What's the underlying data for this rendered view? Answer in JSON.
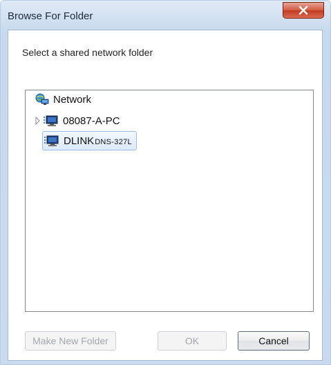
{
  "window": {
    "title": "Browse For Folder"
  },
  "dialog": {
    "instruction": "Select a shared network folder"
  },
  "tree": {
    "root": {
      "label": "Network",
      "icon": "network-icon"
    },
    "items": [
      {
        "label": "08087-A-PC",
        "sub": "",
        "icon": "computer-icon",
        "expandable": true,
        "selected": false
      },
      {
        "label": "DLINK",
        "sub": "DNS-327L",
        "icon": "computer-icon",
        "expandable": false,
        "selected": true
      }
    ]
  },
  "buttons": {
    "make_new_folder": "Make New Folder",
    "ok": "OK",
    "cancel": "Cancel"
  },
  "colors": {
    "title_bar": "#cfdff0",
    "close_button": "#c23a22",
    "selection": "#dce9f8"
  }
}
